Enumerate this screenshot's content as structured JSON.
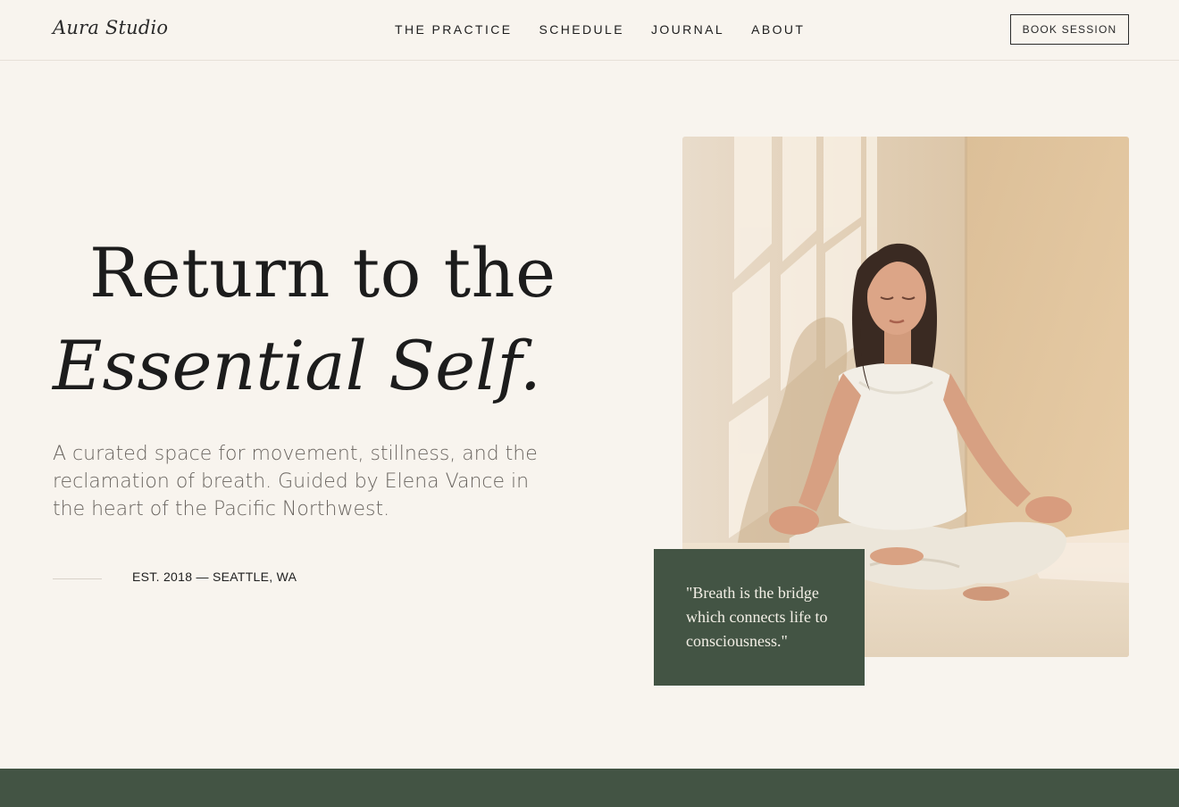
{
  "header": {
    "logo": "Aura Studio",
    "nav": [
      {
        "label": "THE PRACTICE"
      },
      {
        "label": "SCHEDULE"
      },
      {
        "label": "JOURNAL"
      },
      {
        "label": "ABOUT"
      }
    ],
    "cta_label": "BOOK SESSION"
  },
  "hero": {
    "headline_line1": "Return to the",
    "headline_line2": "Essential Self.",
    "intro": "A curated space for movement, stillness, and the reclamation of breath. Guided by Elena Vance in the heart of the Pacific Northwest.",
    "established": "EST. 2018 — SEATTLE, WA",
    "quote": "\"Breath is the bridge which connects life to consciousness.\""
  },
  "colors": {
    "background": "#f8f4ee",
    "accent_green": "#435444",
    "text": "#1c1c1c"
  }
}
